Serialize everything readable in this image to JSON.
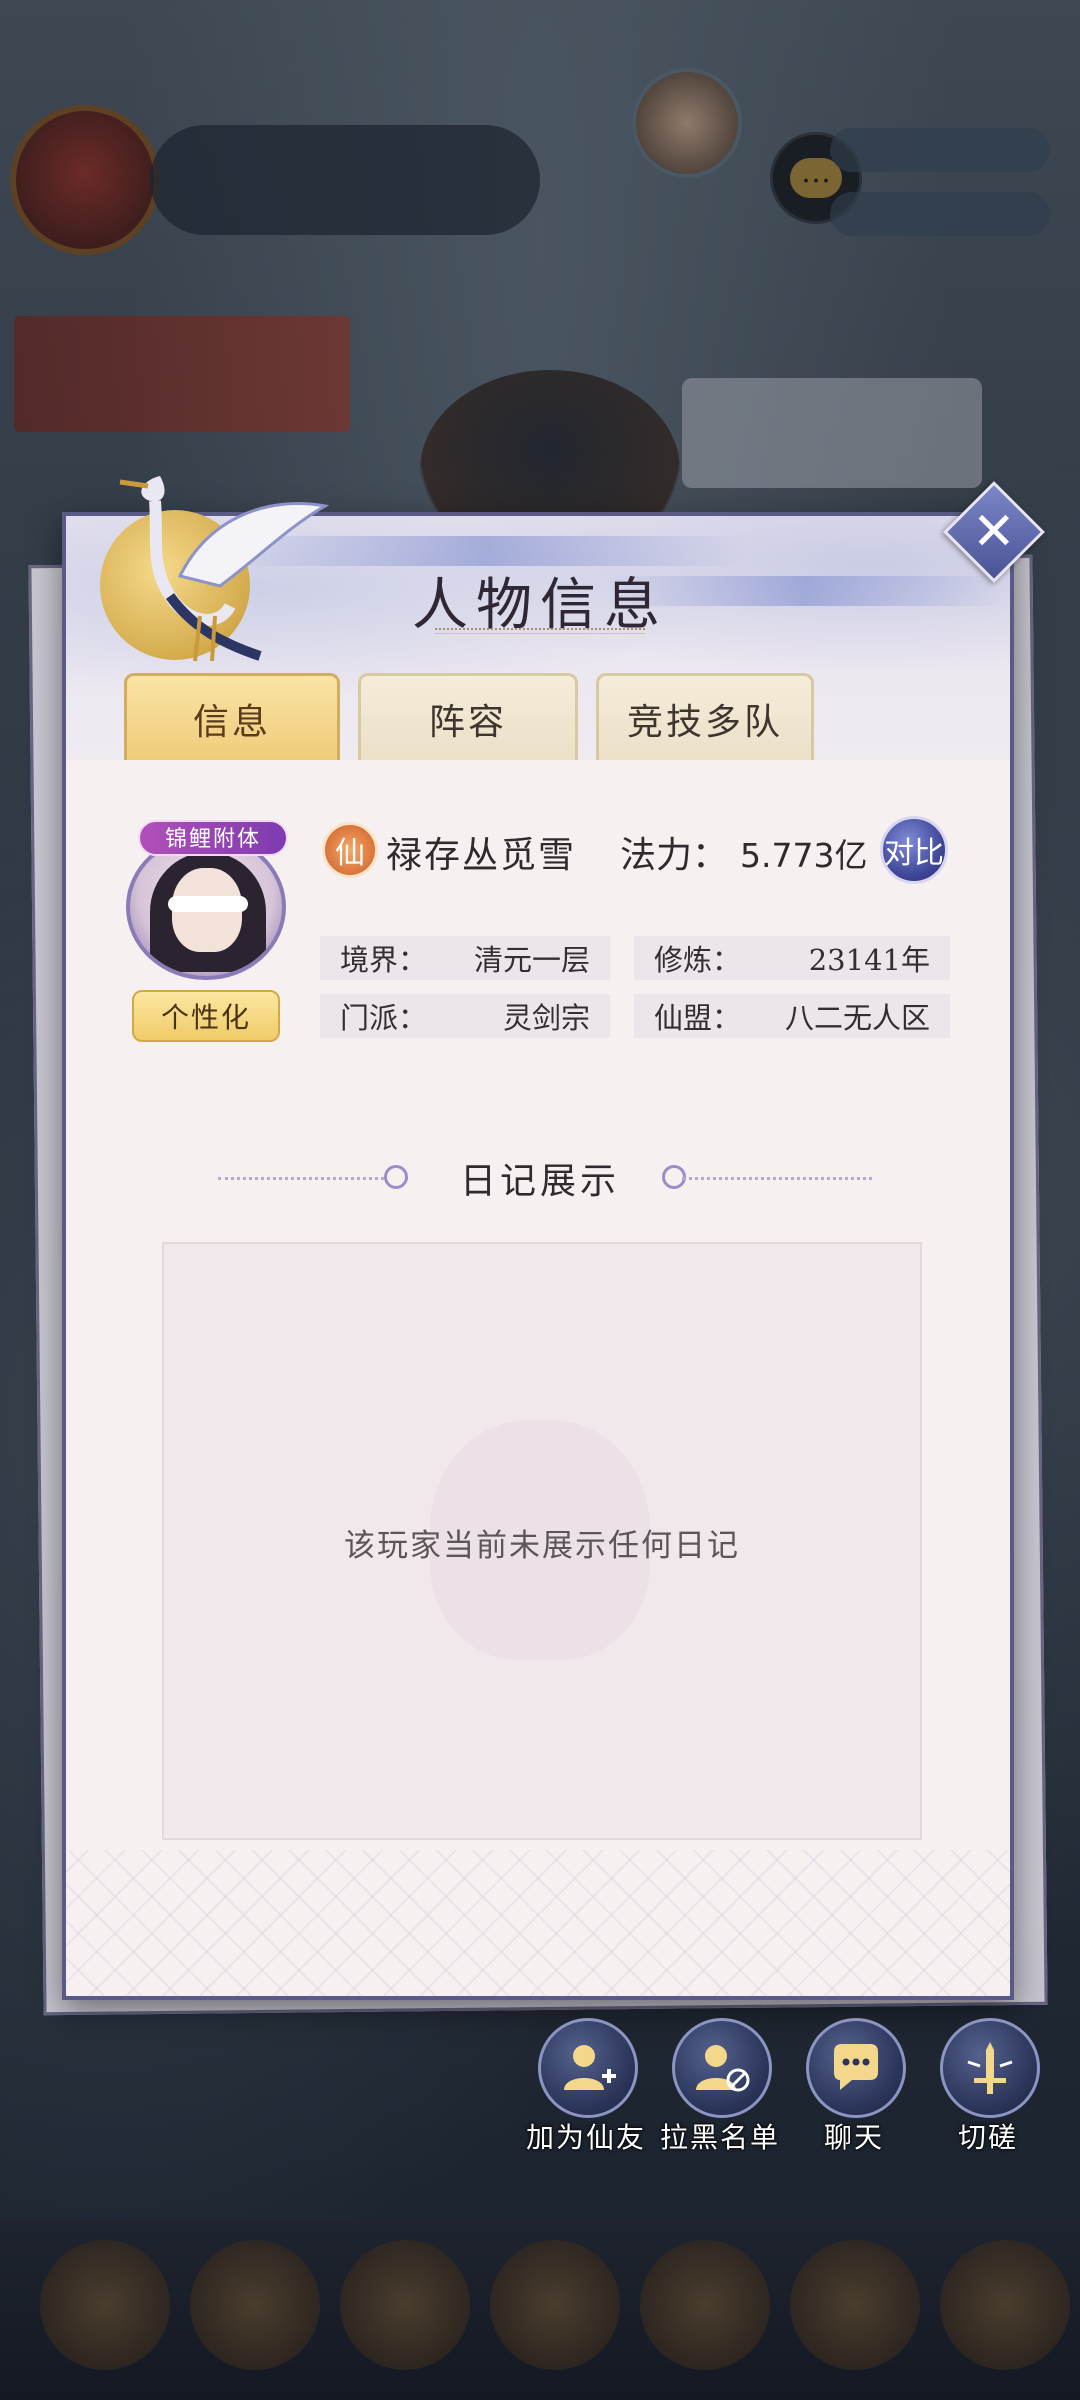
{
  "dialog": {
    "title": "人物信息",
    "close_icon_glyph": "✕"
  },
  "tabs": [
    {
      "label": "信息",
      "active": true
    },
    {
      "label": "阵容",
      "active": false
    },
    {
      "label": "竞技多队",
      "active": false
    }
  ],
  "profile": {
    "avatar_frame_label": "锦鲤附体",
    "personalize_label": "个性化",
    "immortal_badge": "仙",
    "player_name": "禄存丛觅雪",
    "power_label": "法力：",
    "power_value": "5.773亿",
    "compare_label": "对比",
    "stats": [
      {
        "label": "境界：",
        "value": "清元一层"
      },
      {
        "label": "修炼：",
        "value": "23141年"
      },
      {
        "label": "门派：",
        "value": "灵剑宗"
      },
      {
        "label": "仙盟：",
        "value": "八二无人区"
      }
    ]
  },
  "diary": {
    "heading": "日记展示",
    "empty_text": "该玩家当前未展示任何日记"
  },
  "actions": [
    {
      "label": "加为仙友",
      "icon": "add-friend-icon"
    },
    {
      "label": "拉黑名单",
      "icon": "block-user-icon"
    },
    {
      "label": "聊天",
      "icon": "chat-icon"
    },
    {
      "label": "切磋",
      "icon": "sword-icon"
    }
  ],
  "colors": {
    "accent_gold": "#efcc79",
    "frame_purple": "#5a5a86",
    "panel_bg": "#f6f0f1"
  }
}
